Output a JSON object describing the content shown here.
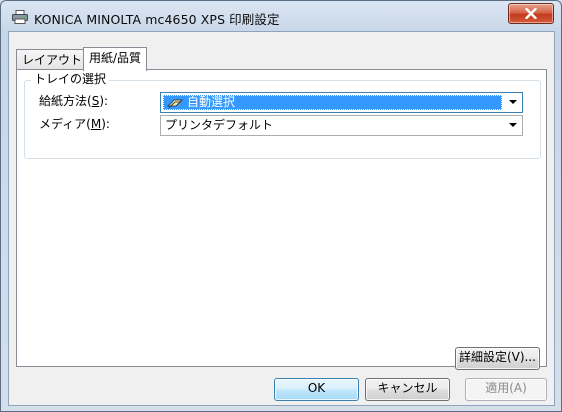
{
  "window": {
    "title": "KONICA MINOLTA mc4650 XPS 印刷設定",
    "close_symbol": "×"
  },
  "tabs": [
    {
      "label": "レイアウト",
      "active": false
    },
    {
      "label": "用紙/品質",
      "active": true
    }
  ],
  "tray_group": {
    "title": "トレイの選択",
    "paper_source": {
      "label": "給紙方法(",
      "accesskey": "S",
      "suffix": "):",
      "value": "自動選択",
      "icon": "printer-tray-icon"
    },
    "media": {
      "label": "メディア(",
      "accesskey": "M",
      "suffix": "):",
      "value": "プリンタデフォルト"
    }
  },
  "advanced_button": "詳細設定(V)...",
  "footer": {
    "ok": "OK",
    "cancel": "キャンセル",
    "apply": "適用(A)"
  },
  "colors": {
    "selection": "#3399ff",
    "close": "#c7452b"
  }
}
